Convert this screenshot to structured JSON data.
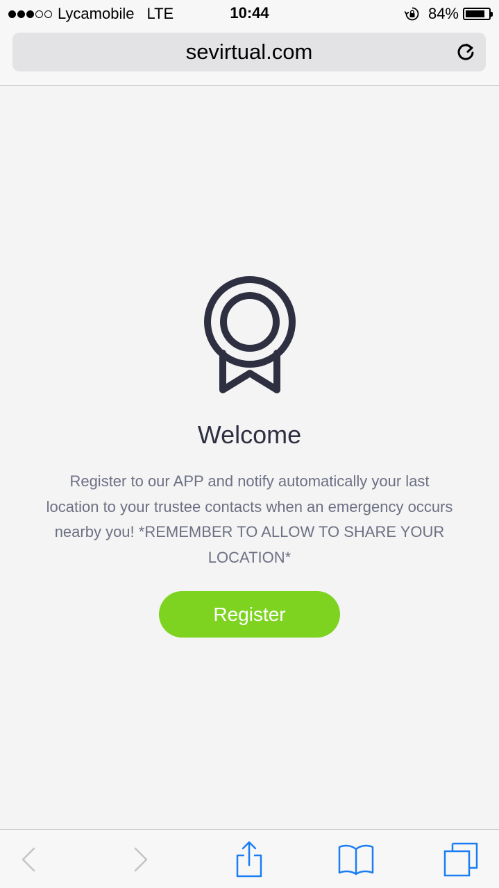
{
  "status_bar": {
    "signal_bars_filled": 3,
    "signal_bars_total": 5,
    "carrier": "Lycamobile",
    "network": "LTE",
    "time": "10:44",
    "battery_percent": "84%",
    "battery_level": 0.84
  },
  "browser": {
    "url": "sevirtual.com"
  },
  "main": {
    "icon": "award-ribbon-icon",
    "title": "Welcome",
    "description": "Register to our APP and notify automatically your last location to your trustee contacts when an emergency occurs nearby you! *REMEMBER TO ALLOW TO SHARE YOUR LOCATION*",
    "register_label": "Register"
  },
  "toolbar": {
    "items": [
      "back-icon",
      "forward-icon",
      "share-icon",
      "bookmarks-icon",
      "tabs-icon"
    ]
  },
  "colors": {
    "accent_green": "#7ed321",
    "icon_dark": "#2e3041",
    "text_gray": "#6d7083",
    "toolbar_blue": "#1a7ef2",
    "background": "#f4f4f4"
  }
}
